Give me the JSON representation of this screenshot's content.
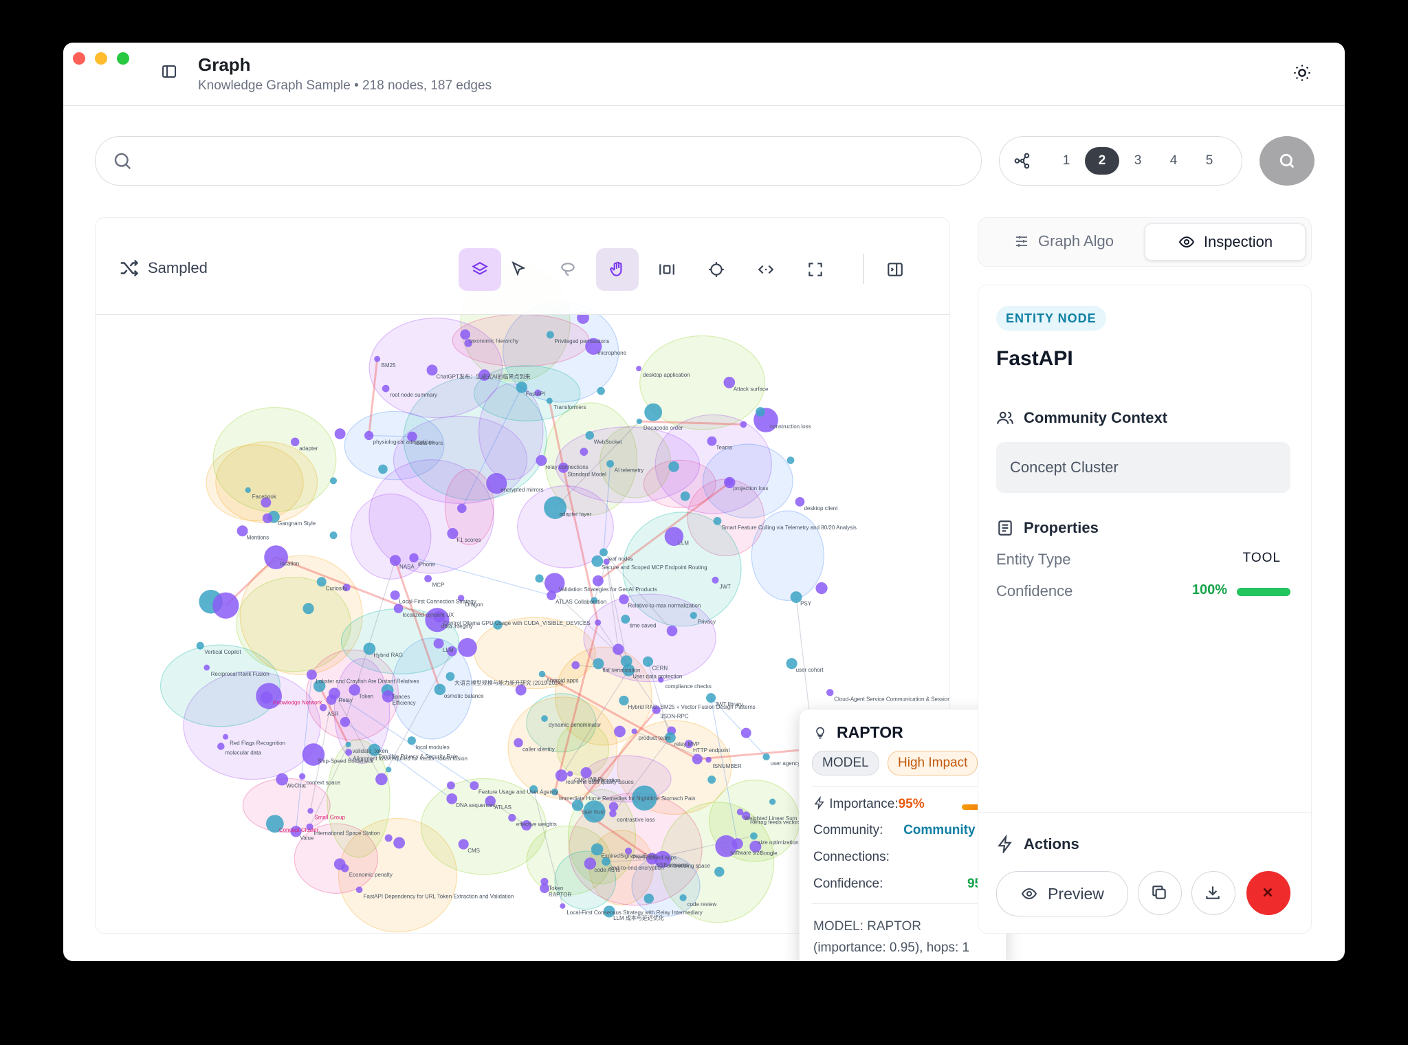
{
  "window": {
    "title": "Graph",
    "subtitle": "Knowledge Graph Sample • 218 nodes, 187 edges"
  },
  "search": {
    "placeholder": "",
    "value": ""
  },
  "hops": {
    "options": [
      "1",
      "2",
      "3",
      "4",
      "5"
    ],
    "selected": "2"
  },
  "graph": {
    "mode_label": "Sampled",
    "tools": [
      "layers-icon",
      "select-pointer-icon",
      "lasso-icon",
      "hand-pan-icon",
      "fit-width-icon",
      "crosshair-icon",
      "code-icon",
      "fullscreen-icon",
      "panel-toggle-icon"
    ],
    "active_tool": "layers-icon",
    "labels": {
      "l01": "Lobster and Crayfish Are Distant Relatives",
      "l02": "Decapoda order",
      "l03": "compliance checks",
      "l04": "DNA sequences",
      "l05": "physiological adaptations",
      "l06": "osmotic balance",
      "l07": "data errors",
      "l08": "context space",
      "l09": "Refrag feeds vectors, not text, to LLM",
      "l10": "ATLAS",
      "l11": "LLM",
      "l12": "adapter layer",
      "l13": "iPhone",
      "l14": "Curiosity",
      "l15": "Local-First Consensus Strategy with Relay Intermediary",
      "l16": "desktop client",
      "l17": "LLM 成本与延迟优化",
      "l18": "Spaces",
      "l19": "PSY",
      "l20": "Efficiency",
      "l21": "Facebook",
      "l22": "Dragon",
      "l23": "JWT",
      "l24": "FastAPI",
      "l25": "大语言模型规模与能力新升研究 (2019-2024)",
      "l26": "end-to-end encryption",
      "l27": "Token",
      "l28": "Pre-installed apps",
      "l29": "Gangnam Style",
      "l30": "Relay",
      "l31": "CMS",
      "l32": "localized consent UX",
      "l33": "JSON-RPC",
      "l34": "NASA",
      "l35": "Local-First Connection Strategy",
      "l36": "Tangible Privacy & Security Rule",
      "l37": "JWT library",
      "l38": "validate_token",
      "l39": "adapter",
      "l40": "Secure and Scoped MCP Endpoint Routing",
      "l41": "Privacy",
      "l42": "relay connections",
      "l43": "molecular data",
      "l44": "WebSocket",
      "l45": "MCP",
      "l46": "Attack surface",
      "l47": "encrypted mirrors",
      "l48": "Cloud-Agent Service Communication & Session Management",
      "l49": "International Space Station",
      "l50": "SSE streams",
      "l51": "Alignment loss required for vector–token fusion",
      "l52": "F1 scores",
      "l53": "relay MVP",
      "l54": "desktop application",
      "l55": "construction loss",
      "l56": "HTTP endpoint",
      "l57": "Red Flags Recognition",
      "l58": "FastAPI Dependency for URL Token Extraction and Validation",
      "l59": "caller identity",
      "l60": "Mentions",
      "l61": "taxonomic hierarchy",
      "l62": "time saved",
      "l63": "contrastive loss",
      "l64": "ATLAS Collaboration",
      "l65": "RAPTOR",
      "l66": "leaf nodes",
      "l67": "root node summary",
      "l68": "embedding space",
      "l69": "User data protection",
      "l70": "Validation Strategies for GenAI Products",
      "l71": "Immediate Home Remedies for Nighttime Stomach Pain",
      "l72": "code ASTs",
      "l73": "WeChat",
      "l74": "MLPs",
      "l75": "local modules",
      "l76": "Vertical Copilot",
      "l77": "Relative-to-max normalization",
      "l78": "Hybrid RAG",
      "l79": "CERN",
      "l80": "Privileged permissions",
      "l81": "Smart Feature Culling via Telemetry and 80/20 Analysis",
      "l82": "CMS Collaboration",
      "l83": "Standard Model",
      "l84": "effective weights",
      "l85": "Transformers",
      "l86": "user trust",
      "l87": "software size",
      "l88": "Weighted Linear Sum",
      "l89": "Vector Fusion",
      "l90": "Reciprocal Rank Fusion",
      "l91": "data integrity",
      "l92": "flat serialization",
      "l93": "ChatGPT发布：生成式AI的临界点到来",
      "l94": "real-time data quality issues",
      "l95": "user agency",
      "l96": "product team",
      "l97": "user cohort",
      "l98": "BM25",
      "l99": "microphone",
      "l100": "code review",
      "l101": "Hybrid RAG: BM25 + Vector Fusion Design Patterns",
      "l102": "dynamic denominator",
      "l103": "Concept Cluster",
      "l104": "AI telemetry",
      "l105": "size optimization",
      "l106": "Feature Usage and User Agency",
      "l107": "LLM",
      "l108": "location",
      "l109": "Android apps",
      "l110": "Economic penalty",
      "l111": "Ship-Speed Bottleneck",
      "l112": "ISNUMBER",
      "l113": "Control Ollama GPU Usage with CUDA_VISIBLE_DEVICES",
      "l114": "ASR",
      "l115": "Google",
      "l116": "Value",
      "l117": "Teams",
      "l118": "Token",
      "l119": "ExpiredSignatureError",
      "l120": "projection loss",
      "l121": "Knowledge Network",
      "l122": "Small Group"
    }
  },
  "tooltip": {
    "name": "RAPTOR",
    "type_badge": "MODEL",
    "impact_badge": "High Impact",
    "importance_label": "Importance:",
    "importance_value": "95%",
    "importance_fraction": 0.95,
    "community_label": "Community:",
    "community_value": "Community 12",
    "connections_label": "Connections:",
    "connections_value": "1",
    "confidence_label": "Confidence:",
    "confidence_value": "95%",
    "description": "MODEL: RAPTOR (importance: 0.95), hops: 1"
  },
  "tabs": {
    "graph_algo": "Graph Algo",
    "inspection": "Inspection",
    "active": "inspection"
  },
  "inspector": {
    "badge": "ENTITY NODE",
    "name": "FastAPI",
    "community_heading": "Community Context",
    "community_value": "Concept Cluster",
    "properties_heading": "Properties",
    "entity_type_label": "Entity Type",
    "entity_type_value": "TOOL",
    "confidence_label": "Confidence",
    "confidence_value": "100%",
    "confidence_fraction": 1.0,
    "actions_heading": "Actions",
    "preview_label": "Preview"
  },
  "colors": {
    "accent_teal": "#0e7fa3",
    "confidence_green": "#16a34a",
    "impact_orange": "#ea580c",
    "delete_red": "#ef2b2b"
  }
}
